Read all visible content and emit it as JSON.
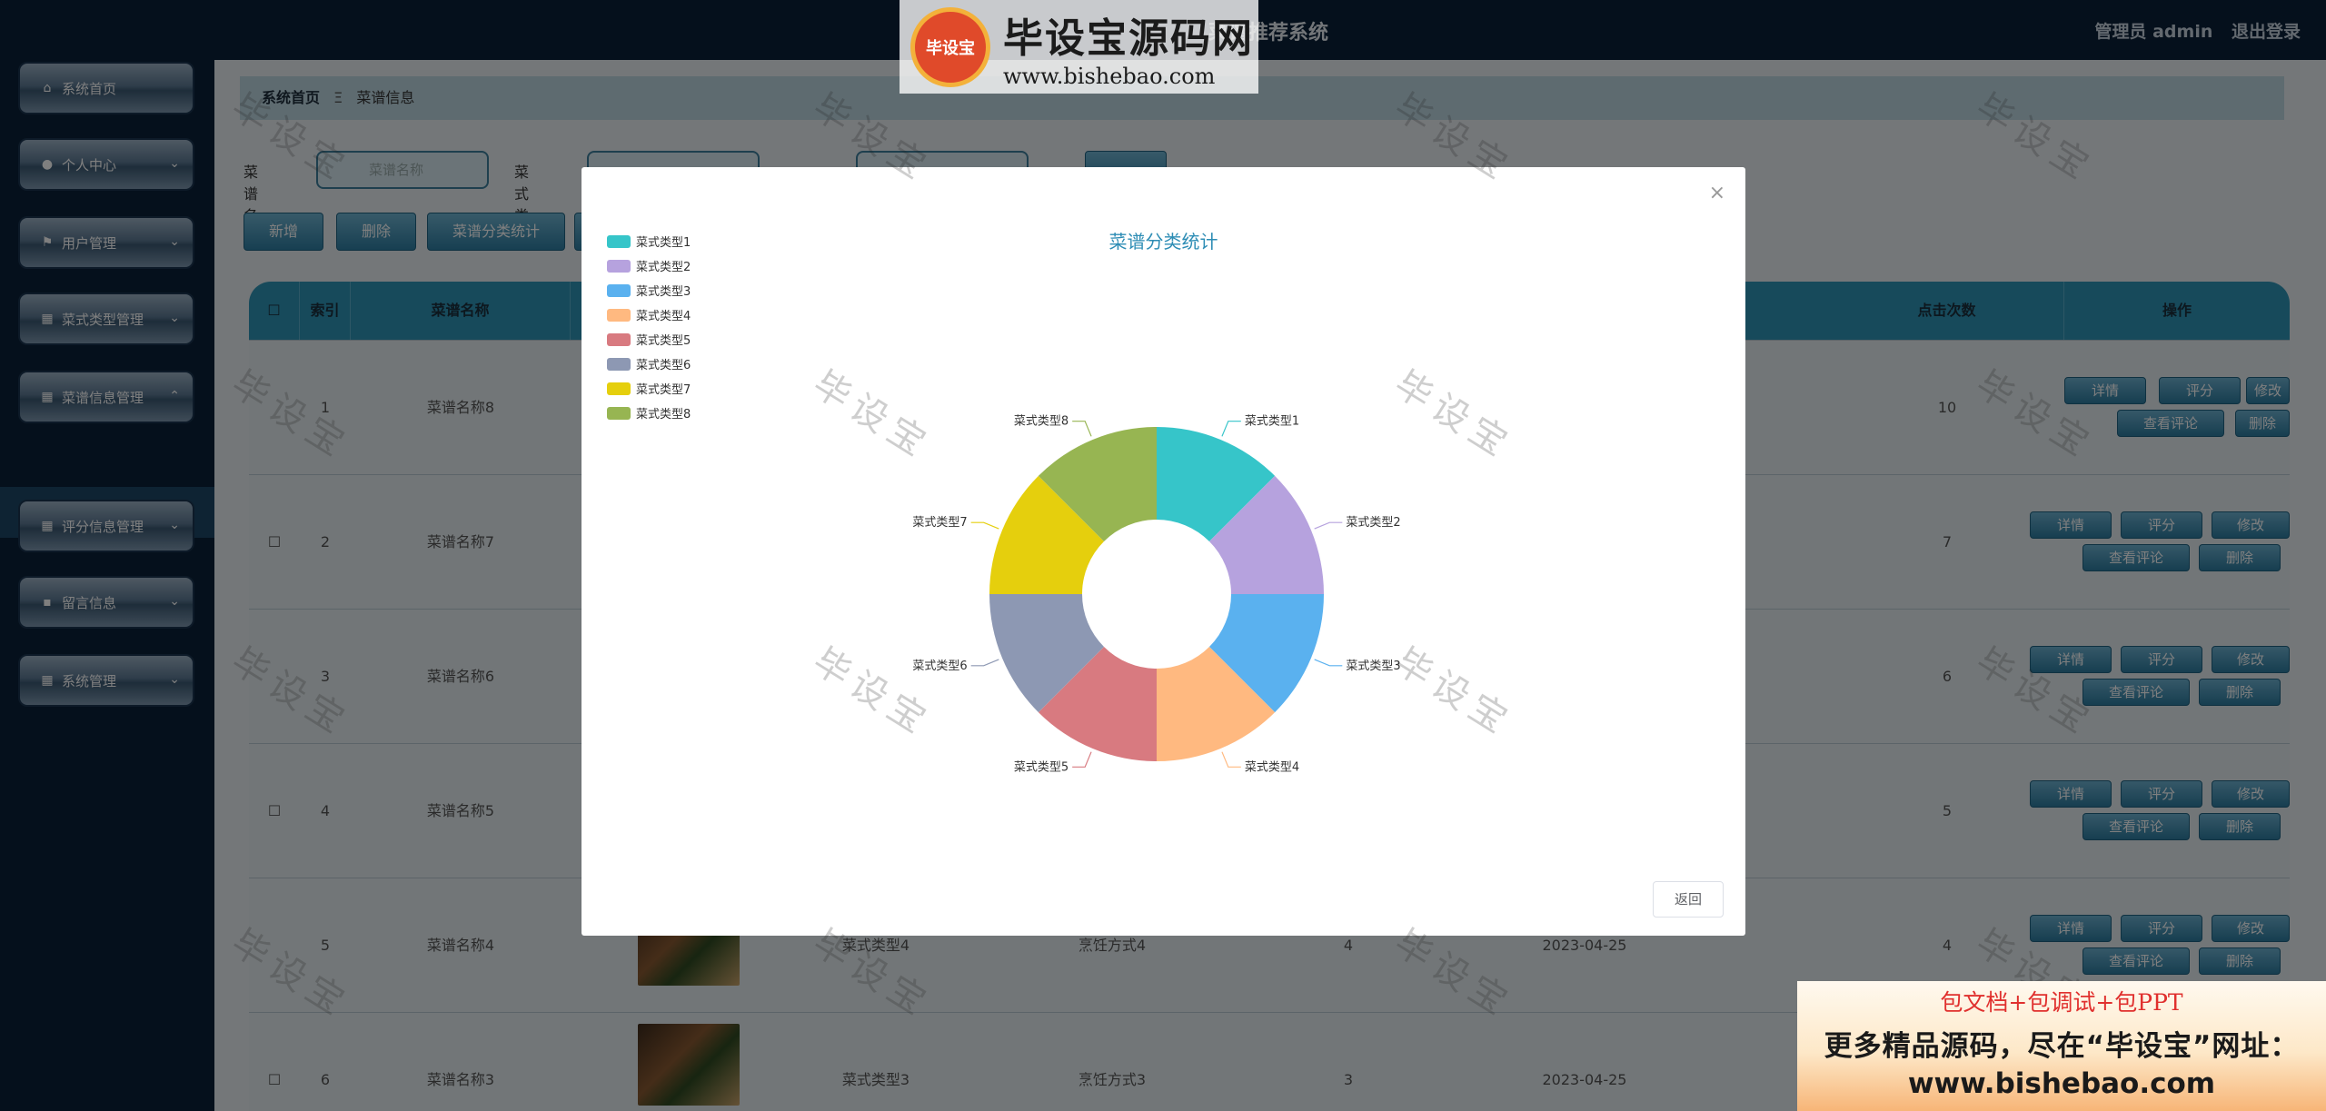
{
  "header": {
    "title": "菜谱推荐系统",
    "user_label": "管理员 admin",
    "logout": "退出登录"
  },
  "watermark": {
    "logo_badge": "毕设宝",
    "logo_title": "毕设宝源码网",
    "logo_url": "www.bishebao.com",
    "stamp": "毕设宝"
  },
  "sidebar": {
    "items": [
      {
        "label": "系统首页",
        "icon": "home-icon"
      },
      {
        "label": "个人中心",
        "icon": "user-icon"
      },
      {
        "label": "用户管理",
        "icon": "flag-icon"
      },
      {
        "label": "菜式类型管理",
        "icon": "grid-icon"
      },
      {
        "label": "菜谱信息管理",
        "icon": "grid-icon"
      },
      {
        "label": "评分信息管理",
        "icon": "grid-icon"
      },
      {
        "label": "留言信息",
        "icon": "message-icon"
      },
      {
        "label": "系统管理",
        "icon": "grid-icon"
      }
    ],
    "active_sub": "菜谱信息"
  },
  "breadcrumb": {
    "home": "系统首页",
    "current": "菜谱信息"
  },
  "search": {
    "name_label": "菜谱名称",
    "name_placeholder": "菜谱名称",
    "type_label": "菜式类型"
  },
  "toolbar": {
    "add": "新增",
    "delete": "删除",
    "stats": "菜谱分类统计"
  },
  "table": {
    "headers": {
      "index": "索引",
      "name": "菜谱名称",
      "clicks": "点击次数",
      "actions": "操作"
    },
    "rows": [
      {
        "index": "1",
        "name": "菜谱名称8",
        "clicks": "10"
      },
      {
        "index": "2",
        "name": "菜谱名称7",
        "clicks": "7"
      },
      {
        "index": "3",
        "name": "菜谱名称6",
        "clicks": "6"
      },
      {
        "index": "4",
        "name": "菜谱名称5",
        "clicks": "5"
      },
      {
        "index": "5",
        "name": "菜谱名称4",
        "clicks": "4",
        "type": "菜式类型4",
        "method": "烹饪方式4",
        "num": "4",
        "date": "2023-04-25"
      },
      {
        "index": "6",
        "name": "菜谱名称3",
        "clicks": "",
        "type": "菜式类型3",
        "method": "烹饪方式3",
        "num": "3",
        "date": "2023-04-25"
      }
    ],
    "op_labels": {
      "detail": "详情",
      "rate": "评分",
      "edit": "修改",
      "comments": "查看评论",
      "delete": "删除"
    }
  },
  "modal": {
    "close": "×",
    "back": "返回",
    "chart_data": {
      "type": "pie",
      "title": "菜谱分类统计",
      "legend_position": "top-left",
      "donut": true,
      "categories": [
        "菜式类型1",
        "菜式类型2",
        "菜式类型3",
        "菜式类型4",
        "菜式类型5",
        "菜式类型6",
        "菜式类型7",
        "菜式类型8"
      ],
      "values": [
        1,
        1,
        1,
        1,
        1,
        1,
        1,
        1
      ],
      "colors": [
        "#36c5c9",
        "#b6a2de",
        "#5ab1ef",
        "#ffb980",
        "#d87a80",
        "#8d98b3",
        "#e5cf0d",
        "#97b552"
      ]
    }
  },
  "ad": {
    "line1": "包文档+包调试+包PPT",
    "line2": "更多精品源码，尽在“毕设宝”网址：",
    "line3": "www.bishebao.com"
  }
}
